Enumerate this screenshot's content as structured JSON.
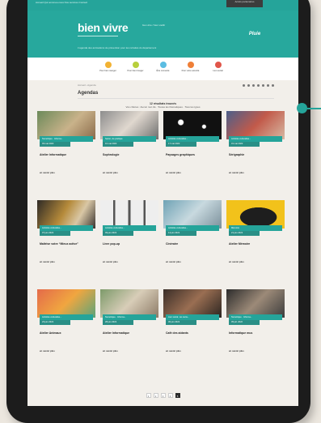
{
  "topbar": {
    "links": "Accueil   Qui sommes-nous   Nos services   Contact",
    "login": "Accès partenaires"
  },
  "banner": {
    "logo": "bien vivre",
    "tagline": "bien être / bien vieillir",
    "slogan": "L’agenda des animations de prévention pour les retraités du département",
    "partner": "Pluie"
  },
  "quicklinks": [
    {
      "label": "Pour bien manger",
      "color": "#f2b233"
    },
    {
      "label": "Pour bien bouger",
      "color": "#b7cf3c"
    },
    {
      "label": "Être connecté",
      "color": "#5bbde2"
    },
    {
      "label": "Pour votre sécurité",
      "color": "#ef7f38"
    },
    {
      "label": "Lien social",
      "color": "#e0564a"
    }
  ],
  "page": {
    "breadcrumb": "Accueil  ›  Agenda",
    "title": "Agendas",
    "count": "12 résultats trouvés",
    "criteria": "Vos critères : Aucun mot clé · Toutes les thématiques · Tous les types"
  },
  "cards": [
    {
      "category": "Numérique · Informa...",
      "date": "03 mai 2022",
      "title": "Atelier Informatique",
      "more": "en savoir plus"
    },
    {
      "category": "Santé, vie pratique",
      "date": "10 mai 2022",
      "title": "Sophrologie",
      "more": "en savoir plus"
    },
    {
      "category": "Activités culturelles...",
      "date": "17 mai 2022",
      "title": "Paysages graphiques",
      "more": "en savoir plus"
    },
    {
      "category": "Activités culturelles...",
      "date": "31 mai 2022",
      "title": "Sérigraphie",
      "more": "en savoir plus"
    },
    {
      "category": "Activités culturelles...",
      "date": "07 juin 2022",
      "title": "Maîtrise votre “Mieux active”",
      "more": "en savoir plus"
    },
    {
      "category": "Activités culturelles...",
      "date": "09 juin 2022",
      "title": "Livre pop-up",
      "more": "en savoir plus"
    },
    {
      "category": "Activités culturelles...",
      "date": "14 juin 2022",
      "title": "Cinéraire",
      "more": "en savoir plus"
    },
    {
      "category": "Mémoire",
      "date": "21 juin 2022",
      "title": "Atelier Mémoire",
      "more": "en savoir plus"
    },
    {
      "category": "Activités culturelles...",
      "date": "23 juin 2022",
      "title": "Atelier Animaux",
      "more": "en savoir plus"
    },
    {
      "category": "Numérique · Informa...",
      "date": "28 juin 2022",
      "title": "Atelier Informatique",
      "more": "en savoir plus"
    },
    {
      "category": "Lien social, vie socia...",
      "date": "30 juin 2022",
      "title": "Café des aidants",
      "more": "en savoir plus"
    },
    {
      "category": "Numérique · Informa...",
      "date": "05 juil. 2022",
      "title": "Informatique mus",
      "more": "en savoir plus"
    }
  ],
  "pagination": [
    "1",
    "2",
    "3",
    "4",
    "5"
  ],
  "colors": {
    "accent": "#25a49a",
    "accent_dark": "#2a8f86"
  }
}
